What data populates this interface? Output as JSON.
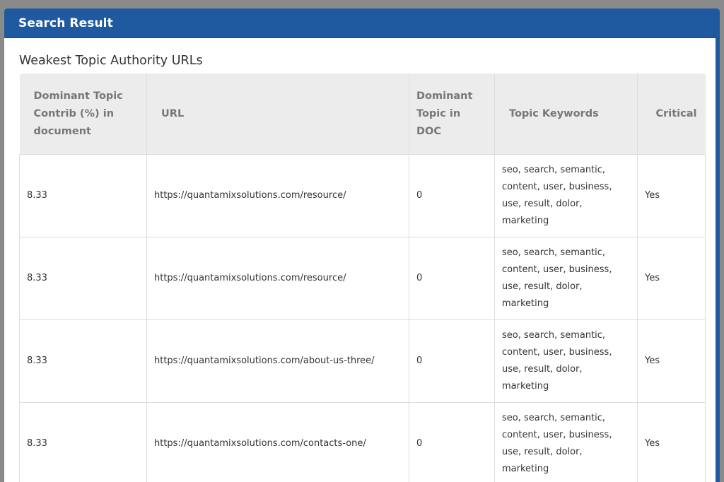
{
  "modal": {
    "title": "Search Result"
  },
  "section": {
    "title": "Weakest Topic Authority URLs"
  },
  "table": {
    "headers": {
      "contrib": "Dominant Topic Contrib (%) in document",
      "url": "URL",
      "dominant": "Dominant Topic in DOC",
      "keywords": "Topic Keywords",
      "critical": "Critical"
    },
    "rows": [
      {
        "contrib": "8.33",
        "url": "https://quantamixsolutions.com/resource/",
        "dominant": "0",
        "keywords": "seo, search, semantic, content, user, business, use, result, dolor, marketing",
        "critical": "Yes"
      },
      {
        "contrib": "8.33",
        "url": "https://quantamixsolutions.com/resource/",
        "dominant": "0",
        "keywords": "seo, search, semantic, content, user, business, use, result, dolor, marketing",
        "critical": "Yes"
      },
      {
        "contrib": "8.33",
        "url": "https://quantamixsolutions.com/about-us-three/",
        "dominant": "0",
        "keywords": "seo, search, semantic, content, user, business, use, result, dolor, marketing",
        "critical": "Yes"
      },
      {
        "contrib": "8.33",
        "url": "https://quantamixsolutions.com/contacts-one/",
        "dominant": "0",
        "keywords": "seo, search, semantic, content, user, business, use, result, dolor, marketing",
        "critical": "Yes"
      }
    ]
  },
  "colors": {
    "header_blue": "#1f5aa0",
    "table_header_bg": "#ececec",
    "table_header_text": "#777777"
  }
}
